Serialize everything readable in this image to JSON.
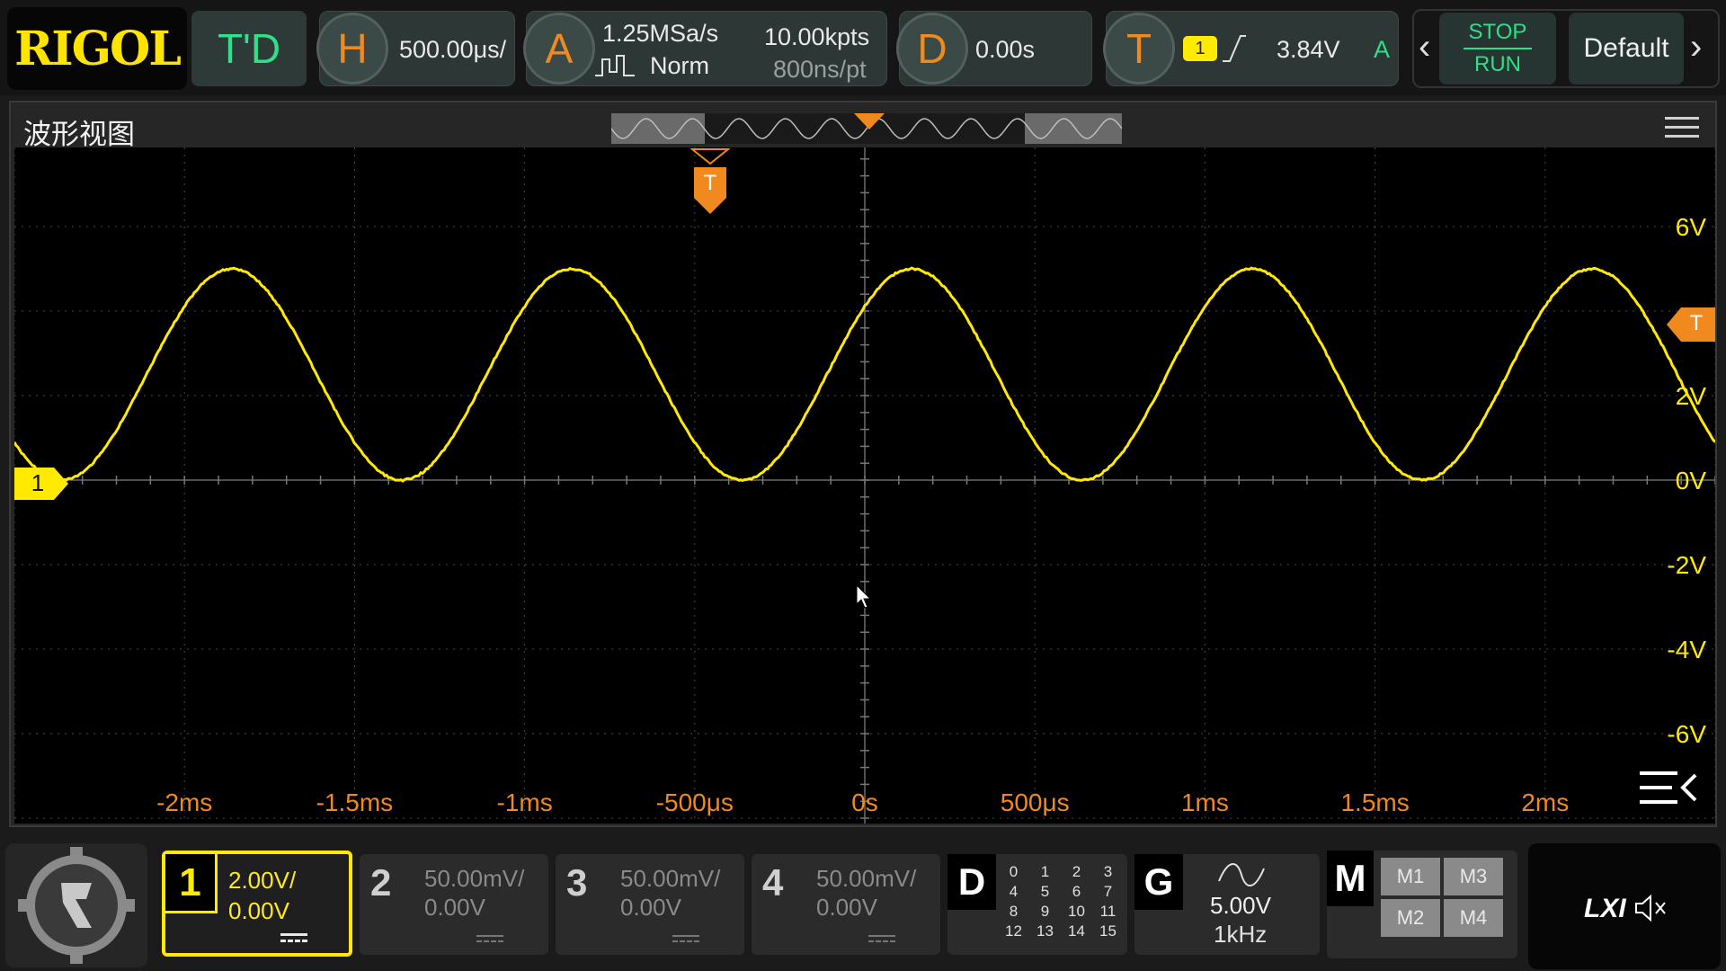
{
  "top": {
    "logo": "RIGOL",
    "mode": "T'D",
    "h_icon": "H",
    "timebase": "500.00μs/",
    "a_icon": "A",
    "sample_rate": "1.25MSa/s",
    "acq_mode": "Norm",
    "mem_depth": "10.00kpts",
    "sample_interval": "800ns/pt",
    "d_icon": "D",
    "delay": "0.00s",
    "t_icon": "T",
    "trig_source": "1",
    "trig_level": "3.84V",
    "trig_mode": "A",
    "stop_label": "STOP",
    "run_label": "RUN",
    "default_label": "Default"
  },
  "window": {
    "title": "波形视图",
    "marker_label": "T",
    "ch1_marker": "1",
    "trig_level_marker": "T"
  },
  "chart_data": {
    "type": "line",
    "title": "",
    "xlabel": "",
    "ylabel": "",
    "x_ticks": [
      "-2ms",
      "-1.5ms",
      "-1ms",
      "-500μs",
      "0s",
      "500μs",
      "1ms",
      "1.5ms",
      "2ms"
    ],
    "y_ticks": [
      "6V",
      "2V",
      "0V",
      "-2V",
      "-4V",
      "-6V"
    ],
    "xlim_ms": [
      -2.5,
      2.5
    ],
    "ylim_V": [
      -8,
      8
    ],
    "grid": true,
    "series": [
      {
        "frequency_hz": 1000,
        "amplitude_V": 2.5,
        "offset_V": 2.5,
        "color": "#ffea00"
      }
    ],
    "trigger_level_V": 3.84
  },
  "channels": [
    {
      "num": "1",
      "scale": "2.00V/",
      "offset": "0.00V"
    },
    {
      "num": "2",
      "scale": "50.00mV/",
      "offset": "0.00V"
    },
    {
      "num": "3",
      "scale": "50.00mV/",
      "offset": "0.00V"
    },
    {
      "num": "4",
      "scale": "50.00mV/",
      "offset": "0.00V"
    }
  ],
  "digital": {
    "label": "D",
    "bits": [
      "0",
      "1",
      "2",
      "3",
      "4",
      "5",
      "6",
      "7",
      "8",
      "9",
      "10",
      "11",
      "12",
      "13",
      "14",
      "15"
    ]
  },
  "gen": {
    "label": "G",
    "amp": "5.00V",
    "freq": "1kHz"
  },
  "math": {
    "label": "M",
    "items": [
      "M1",
      "M3",
      "M2",
      "M4"
    ]
  },
  "lxi": "LXI",
  "colors": {
    "ch1": "#ffea00",
    "accent": "#f08a1e",
    "run": "#2ce088"
  }
}
